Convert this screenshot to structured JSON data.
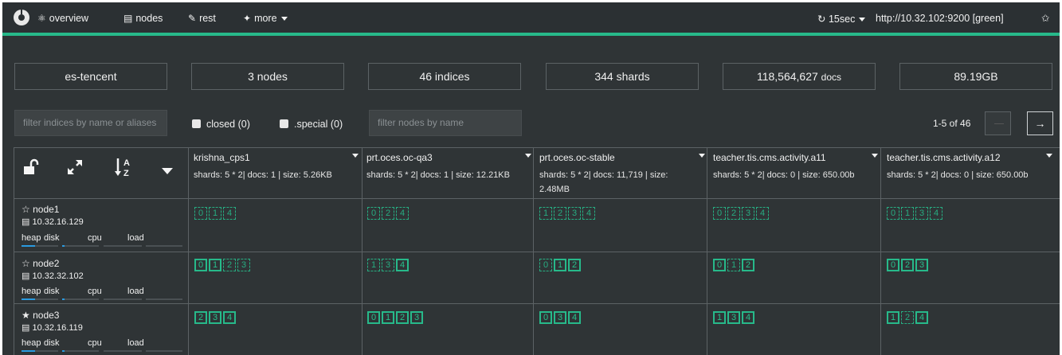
{
  "nav": {
    "overview": "overview",
    "nodes": "nodes",
    "rest": "rest",
    "more": "more",
    "refresh": "15sec",
    "cluster_url": "http://10.32.102:9200 [green]"
  },
  "stats": {
    "cluster": "es-tencent",
    "nodes": "3 nodes",
    "indices": "46 indices",
    "shards": "344 shards",
    "docs_value": "118,564,627",
    "docs_unit": "docs",
    "size": "89.19GB"
  },
  "filters": {
    "indices_placeholder": "filter indices by name or aliases",
    "closed_label": "closed (0)",
    "special_label": ".special (0)",
    "nodes_placeholder": "filter nodes by name",
    "pager": "1-5 of 46",
    "next_label": "→"
  },
  "indices": [
    {
      "name": "krishna_cps1",
      "info": "shards: 5 * 2| docs: 1 | size: 5.26KB"
    },
    {
      "name": "prt.oces.oc-qa3",
      "info": "shards: 5 * 2| docs: 1 | size: 12.21KB"
    },
    {
      "name": "prt.oces.oc-stable",
      "info": "shards: 5 * 2| docs: 11,719 | size: 2.48MB"
    },
    {
      "name": "teacher.tis.cms.activity.a11",
      "info": "shards: 5 * 2| docs: 0 | size: 650.00b"
    },
    {
      "name": "teacher.tis.cms.activity.a12",
      "info": "shards: 5 * 2| docs: 0 | size: 650.00b"
    }
  ],
  "nodes": [
    {
      "name": "node1",
      "ip": "10.32.16.129",
      "master": false
    },
    {
      "name": "node2",
      "ip": "10.32.32.102",
      "master": false
    },
    {
      "name": "node3",
      "ip": "10.32.16.119",
      "master": true
    }
  ],
  "metric_labels": {
    "heap": "heap",
    "disk": "disk",
    "cpu": "cpu",
    "load": "load"
  },
  "shard_grid": [
    [
      [
        {
          "n": "0",
          "t": "r"
        },
        {
          "n": "1",
          "t": "r"
        },
        {
          "n": "4",
          "t": "r"
        }
      ],
      [
        {
          "n": "0",
          "t": "r"
        },
        {
          "n": "2",
          "t": "r"
        },
        {
          "n": "4",
          "t": "r"
        }
      ],
      [
        {
          "n": "1",
          "t": "r"
        },
        {
          "n": "2",
          "t": "r"
        },
        {
          "n": "3",
          "t": "r"
        },
        {
          "n": "4",
          "t": "r"
        }
      ],
      [
        {
          "n": "0",
          "t": "r"
        },
        {
          "n": "2",
          "t": "r"
        },
        {
          "n": "3",
          "t": "r"
        },
        {
          "n": "4",
          "t": "r"
        }
      ],
      [
        {
          "n": "0",
          "t": "r"
        },
        {
          "n": "1",
          "t": "r"
        },
        {
          "n": "3",
          "t": "r"
        },
        {
          "n": "4",
          "t": "r"
        }
      ]
    ],
    [
      [
        {
          "n": "0",
          "t": "p"
        },
        {
          "n": "1",
          "t": "p"
        },
        {
          "n": "2",
          "t": "r"
        },
        {
          "n": "3",
          "t": "r"
        }
      ],
      [
        {
          "n": "1",
          "t": "r"
        },
        {
          "n": "3",
          "t": "r"
        },
        {
          "n": "4",
          "t": "p"
        }
      ],
      [
        {
          "n": "0",
          "t": "r"
        },
        {
          "n": "1",
          "t": "p"
        },
        {
          "n": "2",
          "t": "p"
        }
      ],
      [
        {
          "n": "0",
          "t": "p"
        },
        {
          "n": "1",
          "t": "r"
        },
        {
          "n": "2",
          "t": "p"
        }
      ],
      [
        {
          "n": "0",
          "t": "p"
        },
        {
          "n": "2",
          "t": "p"
        },
        {
          "n": "3",
          "t": "p"
        }
      ]
    ],
    [
      [
        {
          "n": "2",
          "t": "p"
        },
        {
          "n": "3",
          "t": "p"
        },
        {
          "n": "4",
          "t": "p"
        }
      ],
      [
        {
          "n": "0",
          "t": "p"
        },
        {
          "n": "1",
          "t": "p"
        },
        {
          "n": "2",
          "t": "p"
        },
        {
          "n": "3",
          "t": "p"
        }
      ],
      [
        {
          "n": "0",
          "t": "p"
        },
        {
          "n": "3",
          "t": "p"
        },
        {
          "n": "4",
          "t": "p"
        }
      ],
      [
        {
          "n": "1",
          "t": "p"
        },
        {
          "n": "3",
          "t": "p"
        },
        {
          "n": "4",
          "t": "p"
        }
      ],
      [
        {
          "n": "1",
          "t": "p"
        },
        {
          "n": "2",
          "t": "r"
        },
        {
          "n": "4",
          "t": "p"
        }
      ]
    ]
  ],
  "colors": {
    "accent": "#27b98a",
    "bg": "#2f3436",
    "heap_bar": "#2a9be0"
  }
}
